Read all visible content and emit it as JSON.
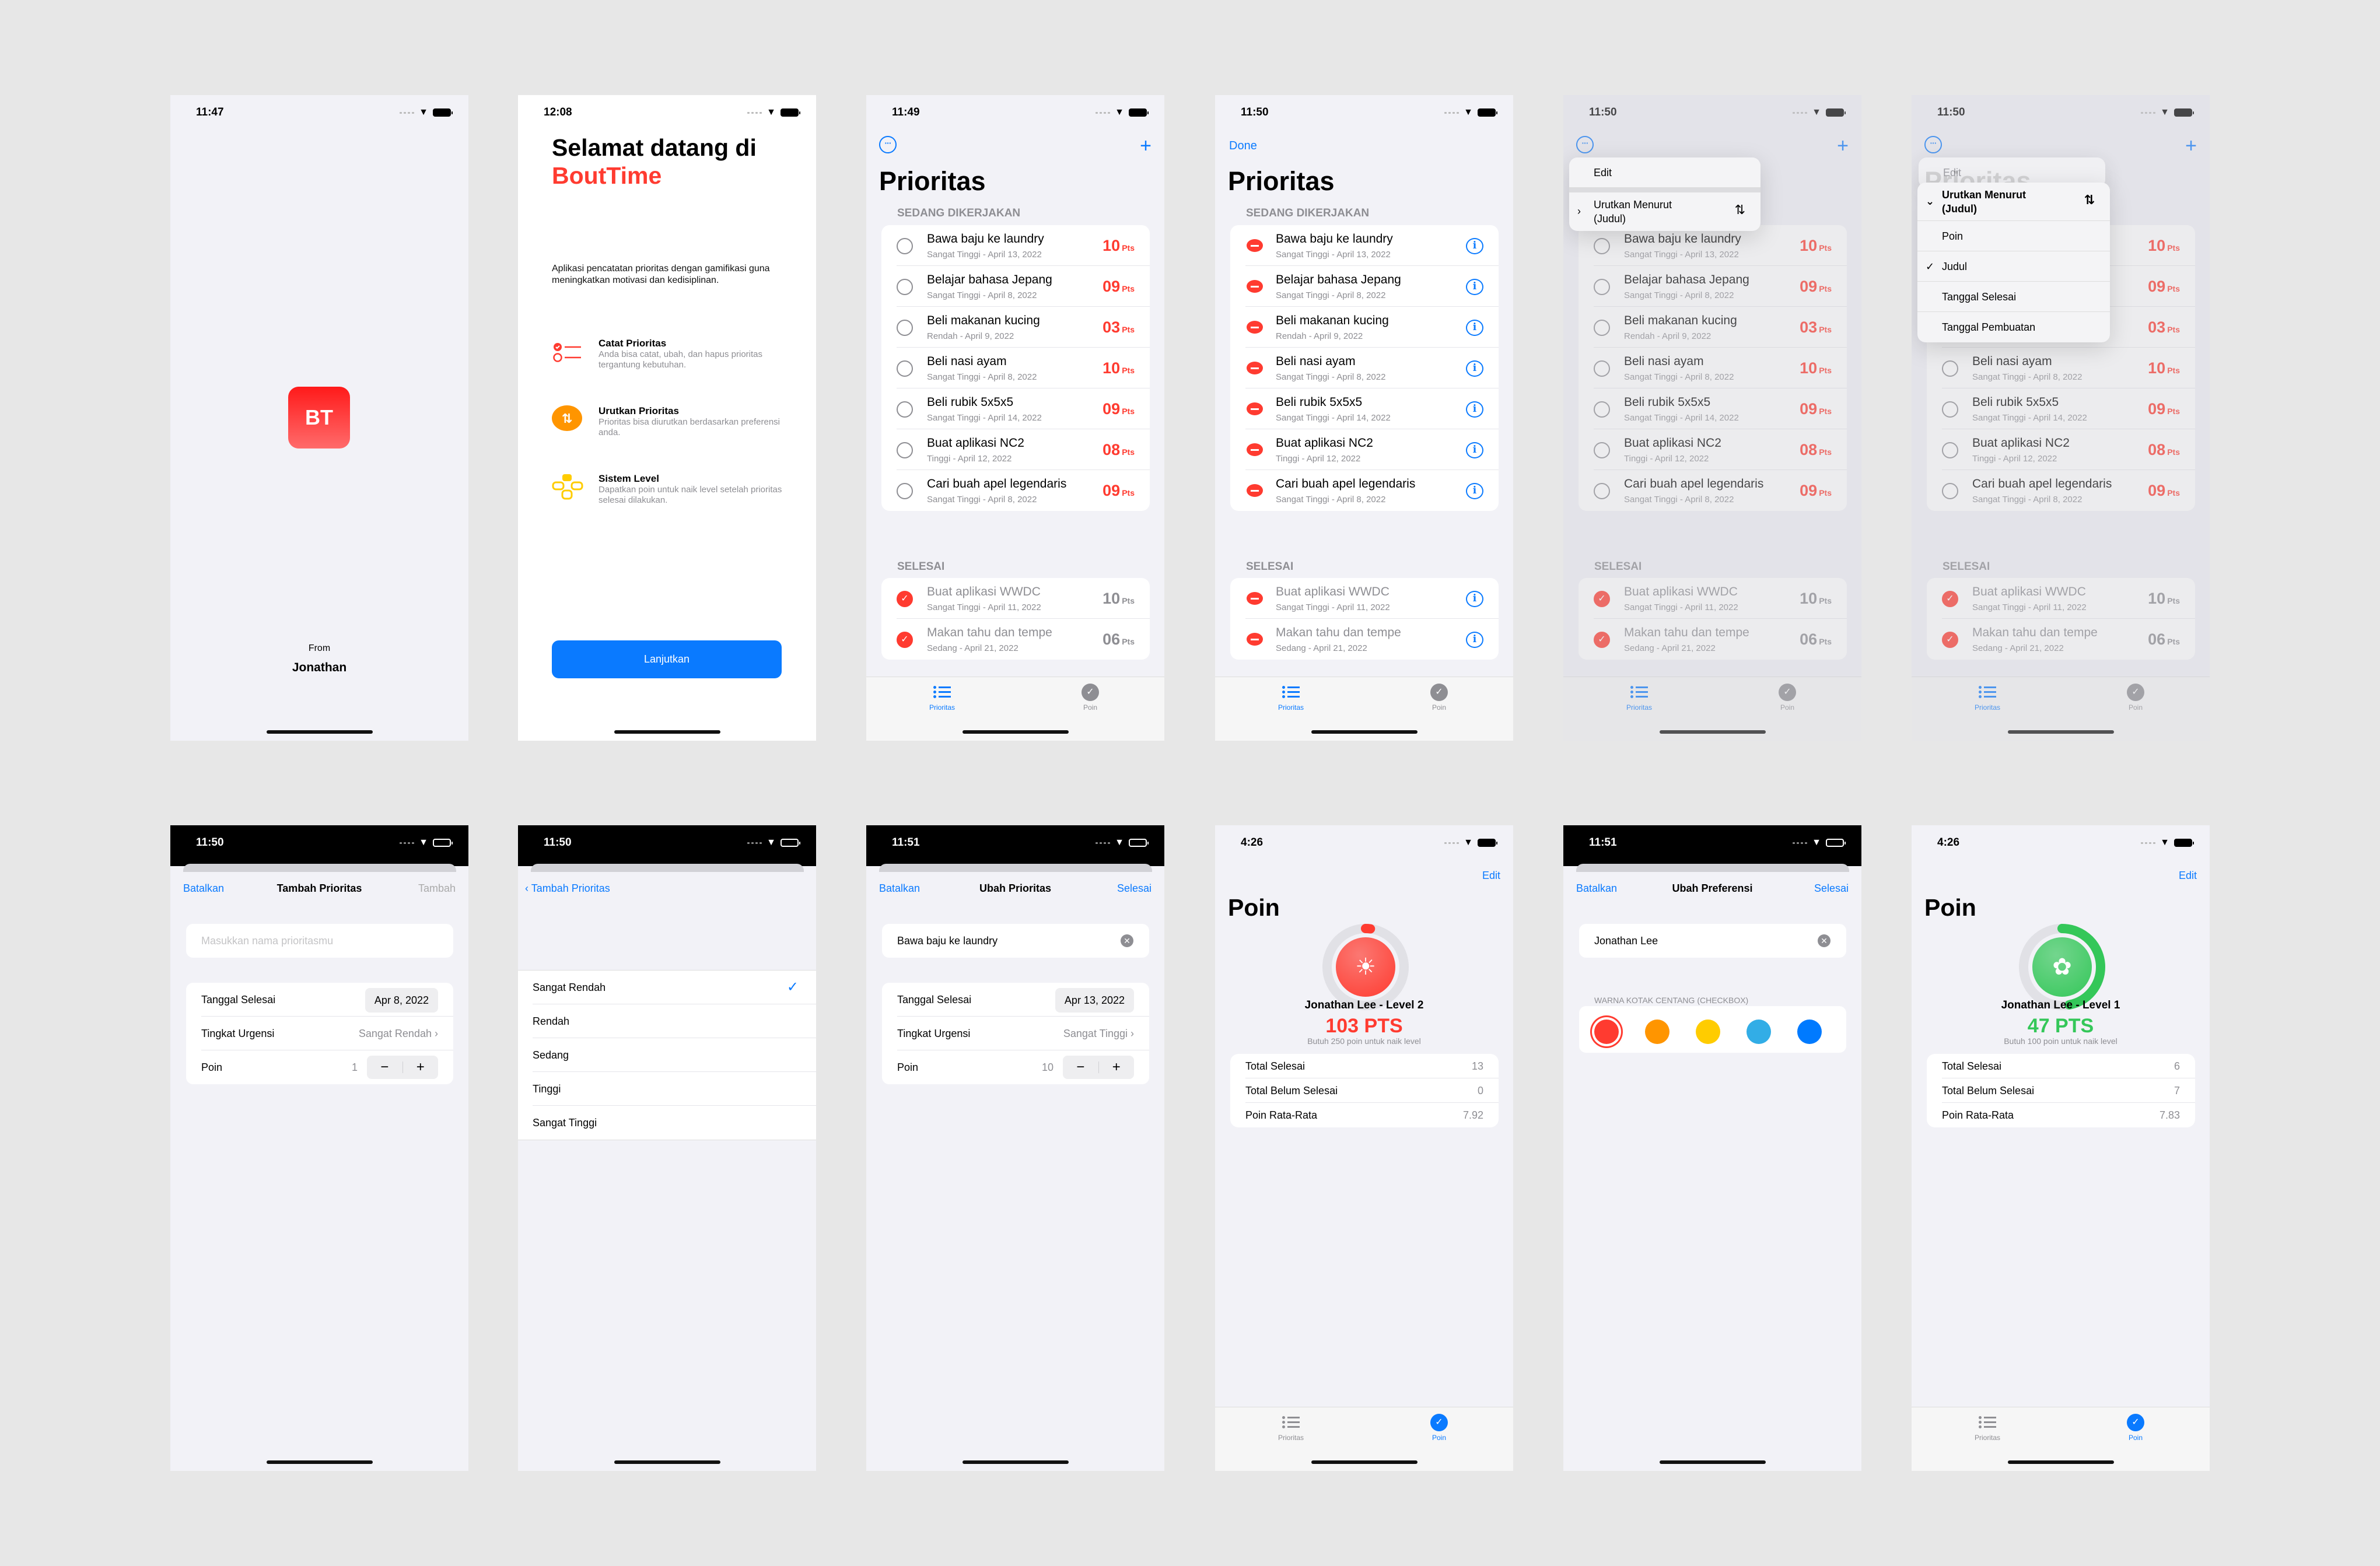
{
  "colors": {
    "accent": "#0a7aff",
    "red": "#ff3b30",
    "green": "#34c759",
    "bg": "#e7e7e7"
  },
  "splash": {
    "time": "11:47",
    "logo": "BT",
    "from": "From",
    "author": "Jonathan"
  },
  "welcome": {
    "time": "12:08",
    "title": "Selamat datang di",
    "brand": "BoutTime",
    "description": "Aplikasi pencatatan prioritas dengan gamifikasi guna meningkatkan motivasi dan kedisiplinan.",
    "features": [
      {
        "icon": "checklist-icon",
        "title": "Catat Prioritas",
        "desc": "Anda bisa catat, ubah, dan hapus prioritas tergantung kebutuhan."
      },
      {
        "icon": "sort-arrows-icon",
        "title": "Urutkan Prioritas",
        "desc": "Prioritas bisa diurutkan berdasarkan preferensi anda."
      },
      {
        "icon": "gamecontroller-icon",
        "title": "Sistem Level",
        "desc": "Dapatkan poin untuk naik level setelah prioritas selesai dilakukan."
      }
    ],
    "button": "Lanjutkan"
  },
  "list": {
    "title": "Prioritas",
    "section_active": "SEDANG DIKERJAKAN",
    "section_done": "SELESAI",
    "done_label": "Done",
    "pts_unit": "Pts",
    "active": [
      {
        "title": "Bawa baju ke laundry",
        "sub": "Sangat Tinggi - April 13, 2022",
        "pts": "10"
      },
      {
        "title": "Belajar bahasa Jepang",
        "sub": "Sangat Tinggi - April 8, 2022",
        "pts": "09"
      },
      {
        "title": "Beli makanan kucing",
        "sub": "Rendah - April 9, 2022",
        "pts": "03"
      },
      {
        "title": "Beli nasi ayam",
        "sub": "Sangat Tinggi - April 8, 2022",
        "pts": "10"
      },
      {
        "title": "Beli rubik 5x5x5",
        "sub": "Sangat Tinggi - April 14, 2022",
        "pts": "09"
      },
      {
        "title": "Buat aplikasi NC2",
        "sub": "Tinggi - April 12, 2022",
        "pts": "08"
      },
      {
        "title": "Cari buah apel legendaris",
        "sub": "Sangat Tinggi - April 8, 2022",
        "pts": "09"
      }
    ],
    "done": [
      {
        "title": "Buat aplikasi WWDC",
        "sub": "Sangat Tinggi - April 11, 2022",
        "pts": "10"
      },
      {
        "title": "Makan tahu dan tempe",
        "sub": "Sedang - April 21, 2022",
        "pts": "06"
      }
    ],
    "times": [
      "11:49",
      "11:50",
      "11:50",
      "11:50"
    ]
  },
  "tabs": [
    {
      "label": "Prioritas",
      "icon": "list-bullet-icon"
    },
    {
      "label": "Poin",
      "icon": "checkmark-seal-icon"
    }
  ],
  "menu": {
    "edit": "Edit",
    "sort_title": "Urutkan Menurut",
    "sort_current": "(Judul)",
    "options": [
      {
        "label": "Poin",
        "checked": false
      },
      {
        "label": "Judul",
        "checked": true
      },
      {
        "label": "Tanggal Selesai",
        "checked": false
      },
      {
        "label": "Tanggal Pembuatan",
        "checked": false
      }
    ]
  },
  "add_form": {
    "time": "11:50",
    "cancel": "Batalkan",
    "title": "Tambah Prioritas",
    "confirm": "Tambah",
    "placeholder": "Masukkan nama prioritasmu",
    "date_label": "Tanggal Selesai",
    "date": "Apr 8, 2022",
    "urgency_label": "Tingkat Urgensi",
    "urgency": "Sangat Rendah",
    "points_label": "Poin",
    "points": "1"
  },
  "urgency_picker": {
    "time": "11:50",
    "back": "Tambah Prioritas",
    "options": [
      {
        "label": "Sangat Rendah",
        "checked": true
      },
      {
        "label": "Rendah",
        "checked": false
      },
      {
        "label": "Sedang",
        "checked": false
      },
      {
        "label": "Tinggi",
        "checked": false
      },
      {
        "label": "Sangat Tinggi",
        "checked": false
      }
    ]
  },
  "edit_form": {
    "time": "11:51",
    "cancel": "Batalkan",
    "title": "Ubah Prioritas",
    "confirm": "Selesai",
    "value": "Bawa baju ke laundry",
    "date_label": "Tanggal Selesai",
    "date": "Apr 13, 2022",
    "urgency_label": "Tingkat Urgensi",
    "urgency": "Sangat Tinggi",
    "points_label": "Poin",
    "points": "10"
  },
  "poin_red": {
    "time": "4:26",
    "edit": "Edit",
    "title": "Poin",
    "user": "Jonathan Lee - Level 2",
    "points": "103 PTS",
    "need": "Butuh 250 poin untuk naik level",
    "progress": 0.02,
    "stats": [
      {
        "label": "Total Selesai",
        "value": "13"
      },
      {
        "label": "Total Belum Selesai",
        "value": "0"
      },
      {
        "label": "Poin Rata-Rata",
        "value": "7.92"
      }
    ]
  },
  "prefs": {
    "time": "11:51",
    "cancel": "Batalkan",
    "title": "Ubah Preferensi",
    "confirm": "Selesai",
    "name": "Jonathan Lee",
    "section": "WARNA KOTAK CENTANG (CHECKBOX)",
    "swatches": [
      {
        "color": "#ff3b30",
        "selected": true
      },
      {
        "color": "#ff9500",
        "selected": false
      },
      {
        "color": "#ffcc00",
        "selected": false
      },
      {
        "color": "#32ade6",
        "selected": false
      },
      {
        "color": "#007aff",
        "selected": false
      }
    ]
  },
  "poin_green": {
    "time": "4:26",
    "edit": "Edit",
    "title": "Poin",
    "user": "Jonathan Lee - Level 1",
    "points": "47 PTS",
    "need": "Butuh 100 poin untuk naik level",
    "progress": 0.47,
    "stats": [
      {
        "label": "Total Selesai",
        "value": "6"
      },
      {
        "label": "Total Belum Selesai",
        "value": "7"
      },
      {
        "label": "Poin Rata-Rata",
        "value": "7.83"
      }
    ]
  }
}
